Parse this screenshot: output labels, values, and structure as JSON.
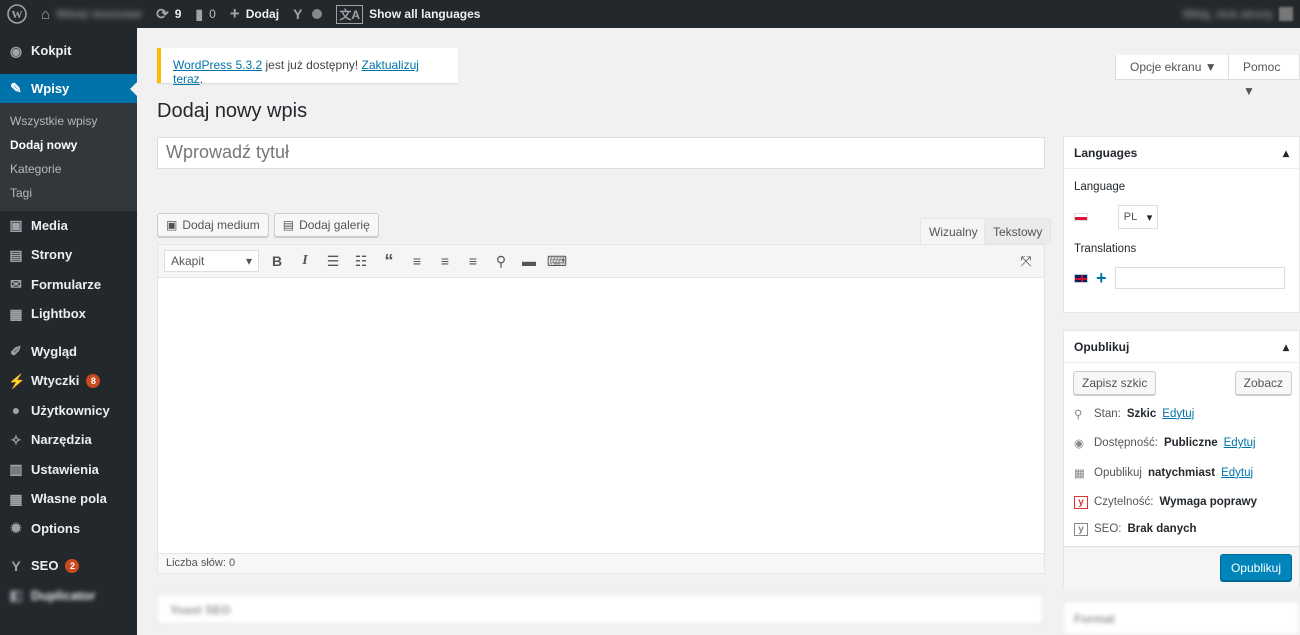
{
  "adminbar": {
    "site_name": "Wiedz terenowe",
    "updates": "9",
    "comments": "0",
    "new_label": "Dodaj",
    "show_languages": "Show all languages",
    "account": "Witaj, nick.strony"
  },
  "sidebar": {
    "items": [
      {
        "label": "Kokpit",
        "icon": "dashboard-icon"
      },
      {
        "label": "Wpisy",
        "icon": "pin-icon"
      },
      {
        "label": "Media",
        "icon": "media-icon"
      },
      {
        "label": "Strony",
        "icon": "page-icon"
      },
      {
        "label": "Formularze",
        "icon": "mail-icon"
      },
      {
        "label": "Lightbox",
        "icon": "lightbox-icon"
      },
      {
        "label": "Wygląd",
        "icon": "brush-icon"
      },
      {
        "label": "Wtyczki",
        "icon": "plugin-icon",
        "badge": "8"
      },
      {
        "label": "Użytkownicy",
        "icon": "user-icon"
      },
      {
        "label": "Narzędzia",
        "icon": "wrench-icon"
      },
      {
        "label": "Ustawienia",
        "icon": "settings-icon"
      },
      {
        "label": "Własne pola",
        "icon": "fields-icon"
      },
      {
        "label": "Options",
        "icon": "gear-icon"
      },
      {
        "label": "SEO",
        "icon": "yoast-icon",
        "badge": "2"
      },
      {
        "label": "Duplicator",
        "icon": "copy-icon"
      }
    ],
    "submenu": [
      "Wszystkie wpisy",
      "Dodaj nowy",
      "Kategorie",
      "Tagi"
    ]
  },
  "screen": {
    "options": "Opcje ekranu ▼",
    "help": "Pomoc ▼"
  },
  "notice": {
    "link1": "WordPress 5.3.2",
    "text": " jest już dostępny! ",
    "link2": "Zaktualizuj teraz",
    "end": "."
  },
  "page": {
    "title": "Dodaj nowy wpis",
    "title_placeholder": "Wprowadź tytuł"
  },
  "editor": {
    "add_media": "Dodaj medium",
    "add_gallery": "Dodaj galerię",
    "tab_visual": "Wizualny",
    "tab_text": "Tekstowy",
    "format": "Akapit",
    "word_count": "Liczba słów: 0"
  },
  "yoast_box": "Yoast SEO",
  "languages": {
    "header": "Languages",
    "language_label": "Language",
    "lang_value": "PL",
    "translations_label": "Translations"
  },
  "publish": {
    "header": "Opublikuj",
    "save_draft": "Zapisz szkic",
    "preview": "Zobacz",
    "status_label": "Stan:",
    "status_value": "Szkic",
    "visibility_label": "Dostępność:",
    "visibility_value": "Publiczne",
    "schedule_label": "Opublikuj",
    "schedule_value": "natychmiast",
    "readability_label": "Czytelność:",
    "readability_value": "Wymaga poprawy",
    "seo_label": "SEO:",
    "seo_value": "Brak danych",
    "edit": "Edytuj",
    "publish_btn": "Opublikuj"
  },
  "format_box": "Format"
}
